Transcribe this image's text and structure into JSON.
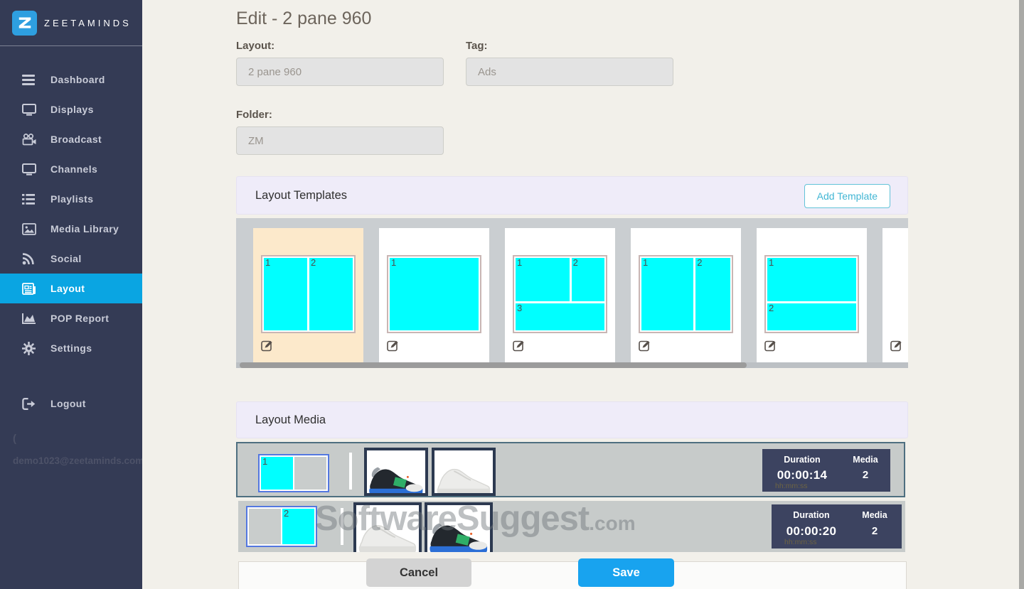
{
  "sidebar": {
    "brand": "ZEETAMINDS",
    "items": [
      {
        "label": "Dashboard",
        "icon": "menu-icon"
      },
      {
        "label": "Displays",
        "icon": "monitor-icon"
      },
      {
        "label": "Broadcast",
        "icon": "video-camera-icon"
      },
      {
        "label": "Channels",
        "icon": "monitor-icon"
      },
      {
        "label": "Playlists",
        "icon": "list-icon"
      },
      {
        "label": "Media Library",
        "icon": "image-icon"
      },
      {
        "label": "Social",
        "icon": "rss-icon"
      },
      {
        "label": "Layout",
        "icon": "newspaper-icon",
        "active": true
      },
      {
        "label": "POP Report",
        "icon": "area-chart-icon"
      },
      {
        "label": "Settings",
        "icon": "gear-icon"
      }
    ],
    "logout_label": "Logout",
    "paren": "(",
    "account_email": "demo1023@zeetaminds.com"
  },
  "page": {
    "title": "Edit - 2 pane 960"
  },
  "form": {
    "layout_label": "Layout:",
    "layout_value": "2 pane 960",
    "tag_label": "Tag:",
    "tag_value": "Ads",
    "folder_label": "Folder:",
    "folder_value": "ZM"
  },
  "templates_panel": {
    "title": "Layout Templates",
    "add_button": "Add Template",
    "templates": [
      {
        "type": "split-vertical-50-50",
        "selected": true,
        "panes": [
          "1",
          "2"
        ]
      },
      {
        "type": "single",
        "panes": [
          "1"
        ]
      },
      {
        "type": "two-top-one-bottom",
        "panes": [
          "1",
          "2",
          "3"
        ]
      },
      {
        "type": "split-vertical-60-40",
        "panes": [
          "1",
          "2"
        ]
      },
      {
        "type": "split-horizontal-62-38",
        "panes": [
          "1",
          "2"
        ]
      },
      {
        "type": "partial-clipped",
        "panes": []
      }
    ]
  },
  "media_panel": {
    "title": "Layout Media",
    "duration_header": "Duration",
    "media_header": "Media",
    "time_format_hint": "hh:mm:ss",
    "rows": [
      {
        "pane_label": "1",
        "duration": "00:00:14",
        "media_count": "2"
      },
      {
        "pane_label": "2",
        "duration": "00:00:20",
        "media_count": "2"
      }
    ]
  },
  "footer": {
    "cancel_label": "Cancel",
    "save_label": "Save"
  },
  "watermark": {
    "main": "SoftwareSuggest",
    "suffix": ".com"
  },
  "colors": {
    "accent_blue": "#18a3ef",
    "active_nav_blue": "#0aa5e2",
    "pane_cyan": "#00ffff",
    "selected_template_bg": "#fce9cb",
    "duration_panel_bg": "#3c4360",
    "sidebar_bg": "#343b55"
  }
}
